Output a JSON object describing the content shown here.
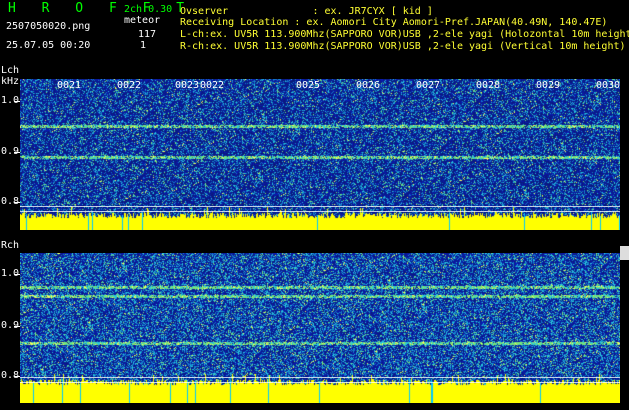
{
  "header": {
    "logo": "H R O F F T",
    "version": "2ch 0.30",
    "filename": "2507050020.png",
    "datetime": "25.07.05 00:20",
    "meteor_label": "meteor",
    "lch_count": "117",
    "rch_count": "1",
    "observer": "Ovserver              : ex. JR7CYX [ kid ]",
    "location": "Receiving Location : ex. Aomori City Aomori-Pref.JAPAN(40.49N, 140.47E)",
    "lch_info": "L-ch:ex. UV5R 113.900Mhz(SAPPORO VOR)USB ,2-ele yagi (Holozontal 10m height",
    "rch_info": "R-ch:ex. UV5R 113.900Mhz(SAPPORO VOR)USB ,2-ele yagi (Vertical 10m height)"
  },
  "lch": {
    "title": "Lch",
    "unit": "kHz",
    "ticks": [
      "1.0",
      "0.9",
      "0.8"
    ],
    "timestamps": [
      "0021",
      "0022",
      "0023",
      "0022",
      "0025",
      "0026",
      "0027",
      "0028",
      "0029",
      "0030"
    ],
    "edge_mark": "2"
  },
  "rch": {
    "title": "Rch",
    "ticks": [
      "1.0",
      "0.9",
      "0.8"
    ]
  },
  "colors": {
    "background": "#000000",
    "noise": "#0a2a9a",
    "signal": "#ffff00",
    "text_green": "#00ff00"
  }
}
